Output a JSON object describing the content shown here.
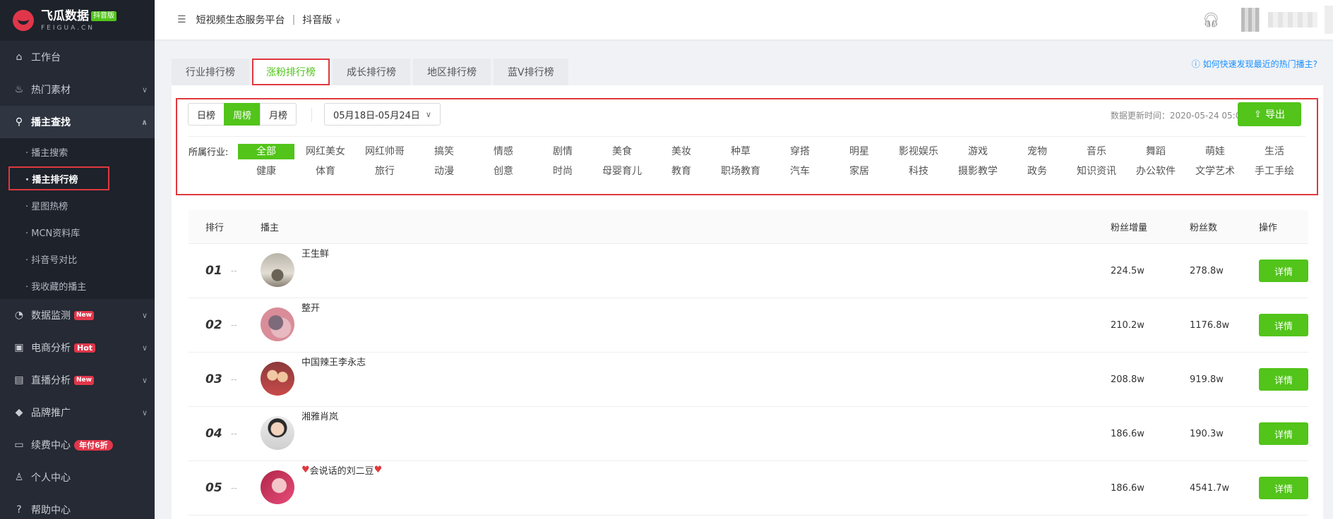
{
  "logo": {
    "cn": "飞瓜数据",
    "badge": "抖音版",
    "en": "FEIGUA.CN"
  },
  "sidebar": {
    "items": [
      {
        "label": "工作台",
        "icon": "home-icon"
      },
      {
        "label": "热门素材",
        "icon": "fire-icon"
      },
      {
        "label": "播主查找",
        "icon": "search-icon"
      },
      {
        "label": "数据监测",
        "icon": "monitor-icon",
        "tag": "New"
      },
      {
        "label": "电商分析",
        "icon": "shop-icon",
        "tag": "Hot"
      },
      {
        "label": "直播分析",
        "icon": "live-icon",
        "tag": "New"
      },
      {
        "label": "品牌推广",
        "icon": "diamond-icon"
      },
      {
        "label": "续费中心",
        "icon": "card-icon",
        "tag": "年付6折"
      },
      {
        "label": "个人中心",
        "icon": "user-icon"
      },
      {
        "label": "帮助中心",
        "icon": "help-icon"
      }
    ],
    "sub": [
      {
        "label": "· 播主搜索"
      },
      {
        "label": "· 播主排行榜"
      },
      {
        "label": "· 星图热榜"
      },
      {
        "label": "· MCN资料库"
      },
      {
        "label": "· 抖音号对比"
      },
      {
        "label": "· 我收藏的播主"
      }
    ]
  },
  "header": {
    "platform": "短视频生态服务平台",
    "separator": "|",
    "version": "抖音版"
  },
  "tabs": [
    "行业排行榜",
    "涨粉排行榜",
    "成长排行榜",
    "地区排行榜",
    "蓝V排行榜"
  ],
  "help_link": "如何快速发现最近的热门播主?",
  "filter": {
    "ranges": [
      "日榜",
      "周榜",
      "月榜"
    ],
    "date_range": "05月18日-05月24日",
    "updated": "数据更新时间：2020-05-24 05:00",
    "export": "导出",
    "industry_label": "所属行业:",
    "industries": [
      "全部",
      "网红美女",
      "网红帅哥",
      "搞笑",
      "情感",
      "剧情",
      "美食",
      "美妆",
      "种草",
      "穿搭",
      "明星",
      "影视娱乐",
      "游戏",
      "宠物",
      "音乐",
      "舞蹈",
      "萌娃",
      "生活",
      "健康",
      "体育",
      "旅行",
      "动漫",
      "创意",
      "时尚",
      "母婴育儿",
      "教育",
      "职场教育",
      "汽车",
      "家居",
      "科技",
      "摄影教学",
      "政务",
      "知识资讯",
      "办公软件",
      "文学艺术",
      "手工手绘"
    ]
  },
  "table": {
    "headers": {
      "rank": "排行",
      "anchor": "播主",
      "increase": "粉丝增量",
      "fans": "粉丝数",
      "op": "操作"
    },
    "rows": [
      {
        "rank": "01",
        "change": "--",
        "name": "王生鲜",
        "increase": "224.5w",
        "fans": "278.8w",
        "btn": "详情"
      },
      {
        "rank": "02",
        "change": "--",
        "name": "整开",
        "increase": "210.2w",
        "fans": "1176.8w",
        "btn": "详情"
      },
      {
        "rank": "03",
        "change": "--",
        "name": "中国辣王李永志",
        "increase": "208.8w",
        "fans": "919.8w",
        "btn": "详情"
      },
      {
        "rank": "04",
        "change": "--",
        "name": "湘雅肖岚",
        "increase": "186.6w",
        "fans": "190.3w",
        "btn": "详情"
      },
      {
        "rank": "05",
        "change": "--",
        "name": "会说话的刘二豆",
        "increase": "186.6w",
        "fans": "4541.7w",
        "btn": "详情"
      }
    ]
  }
}
